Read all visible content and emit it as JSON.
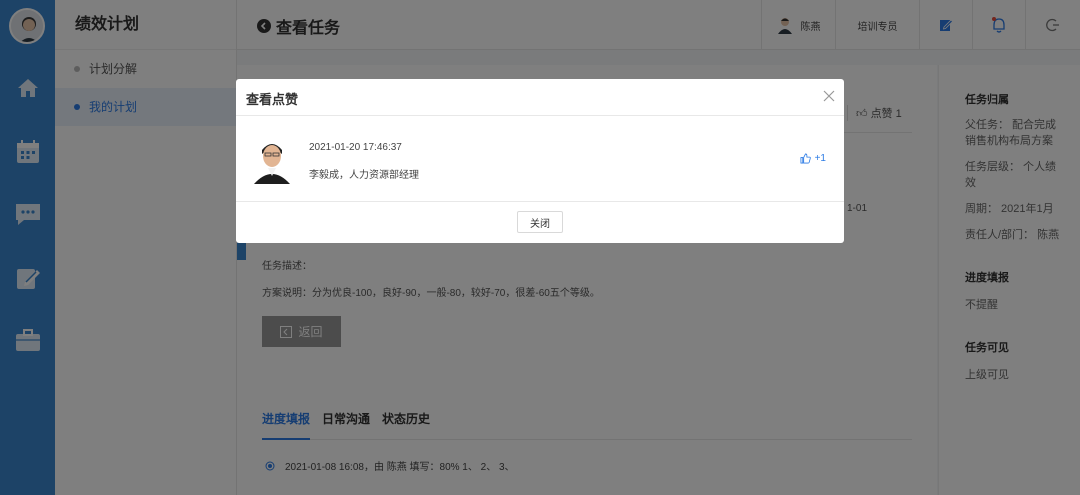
{
  "sidebar": {
    "title": "绩效计划",
    "items": [
      {
        "label": "计划分解"
      },
      {
        "label": "我的计划"
      }
    ]
  },
  "header": {
    "page_title": "查看任务",
    "user_name": "陈燕",
    "role": "培训专员"
  },
  "main": {
    "like_count_label": "点赞 1",
    "date_fragment": "1-01",
    "description_label": "任务描述：",
    "plan_description": "方案说明：分为优良-100，良好-90，一般-80，较好-70，很差-60五个等级。",
    "return_button": "返回",
    "tabs": [
      {
        "label": "进度填报"
      },
      {
        "label": "日常沟通"
      },
      {
        "label": "状态历史"
      }
    ],
    "history_entry": "2021-01-08 16:08，由 陈燕 填写：80% 1、 2、 3、"
  },
  "right_panel": {
    "section1_title": "任务归属",
    "parent_task": "父任务： 配合完成销售机构布局方案",
    "task_level": "任务层级： 个人绩效",
    "period": "周期： 2021年1月",
    "owner": "责任人/部门： 陈燕",
    "section2_title": "进度填报",
    "progress_value": "不提醒",
    "section3_title": "任务可见",
    "visibility_value": "上级可见"
  },
  "modal": {
    "title": "查看点赞",
    "entry_time": "2021-01-20 17:46:37",
    "entry_person": "李毅成，人力资源部经理",
    "like_label": "+1",
    "close_button": "关闭"
  },
  "colors": {
    "rail": "#3a86cf",
    "accent": "#2c7be5",
    "overlay": "rgba(0,0,0,0.5)"
  }
}
